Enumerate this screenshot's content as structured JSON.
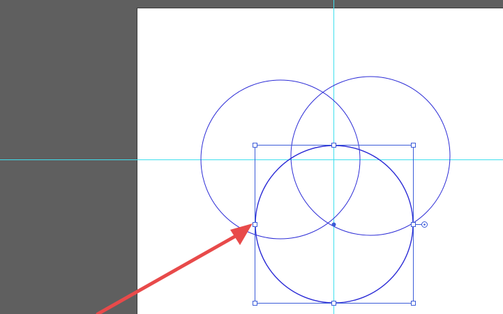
{
  "canvas": {
    "artboard_color": "#ffffff",
    "pasteboard_color": "#5f5f5f",
    "guide_color": "#3fe0ee",
    "path_color": "#2b2bd6",
    "selection_color": "#3b5bd8",
    "arrow_color": "#e84a4a"
  },
  "objects": [
    {
      "name": "circle-left",
      "selected": false
    },
    {
      "name": "circle-right",
      "selected": false
    },
    {
      "name": "circle-bottom",
      "selected": true
    }
  ],
  "guides": {
    "vertical": true,
    "horizontal": true
  }
}
